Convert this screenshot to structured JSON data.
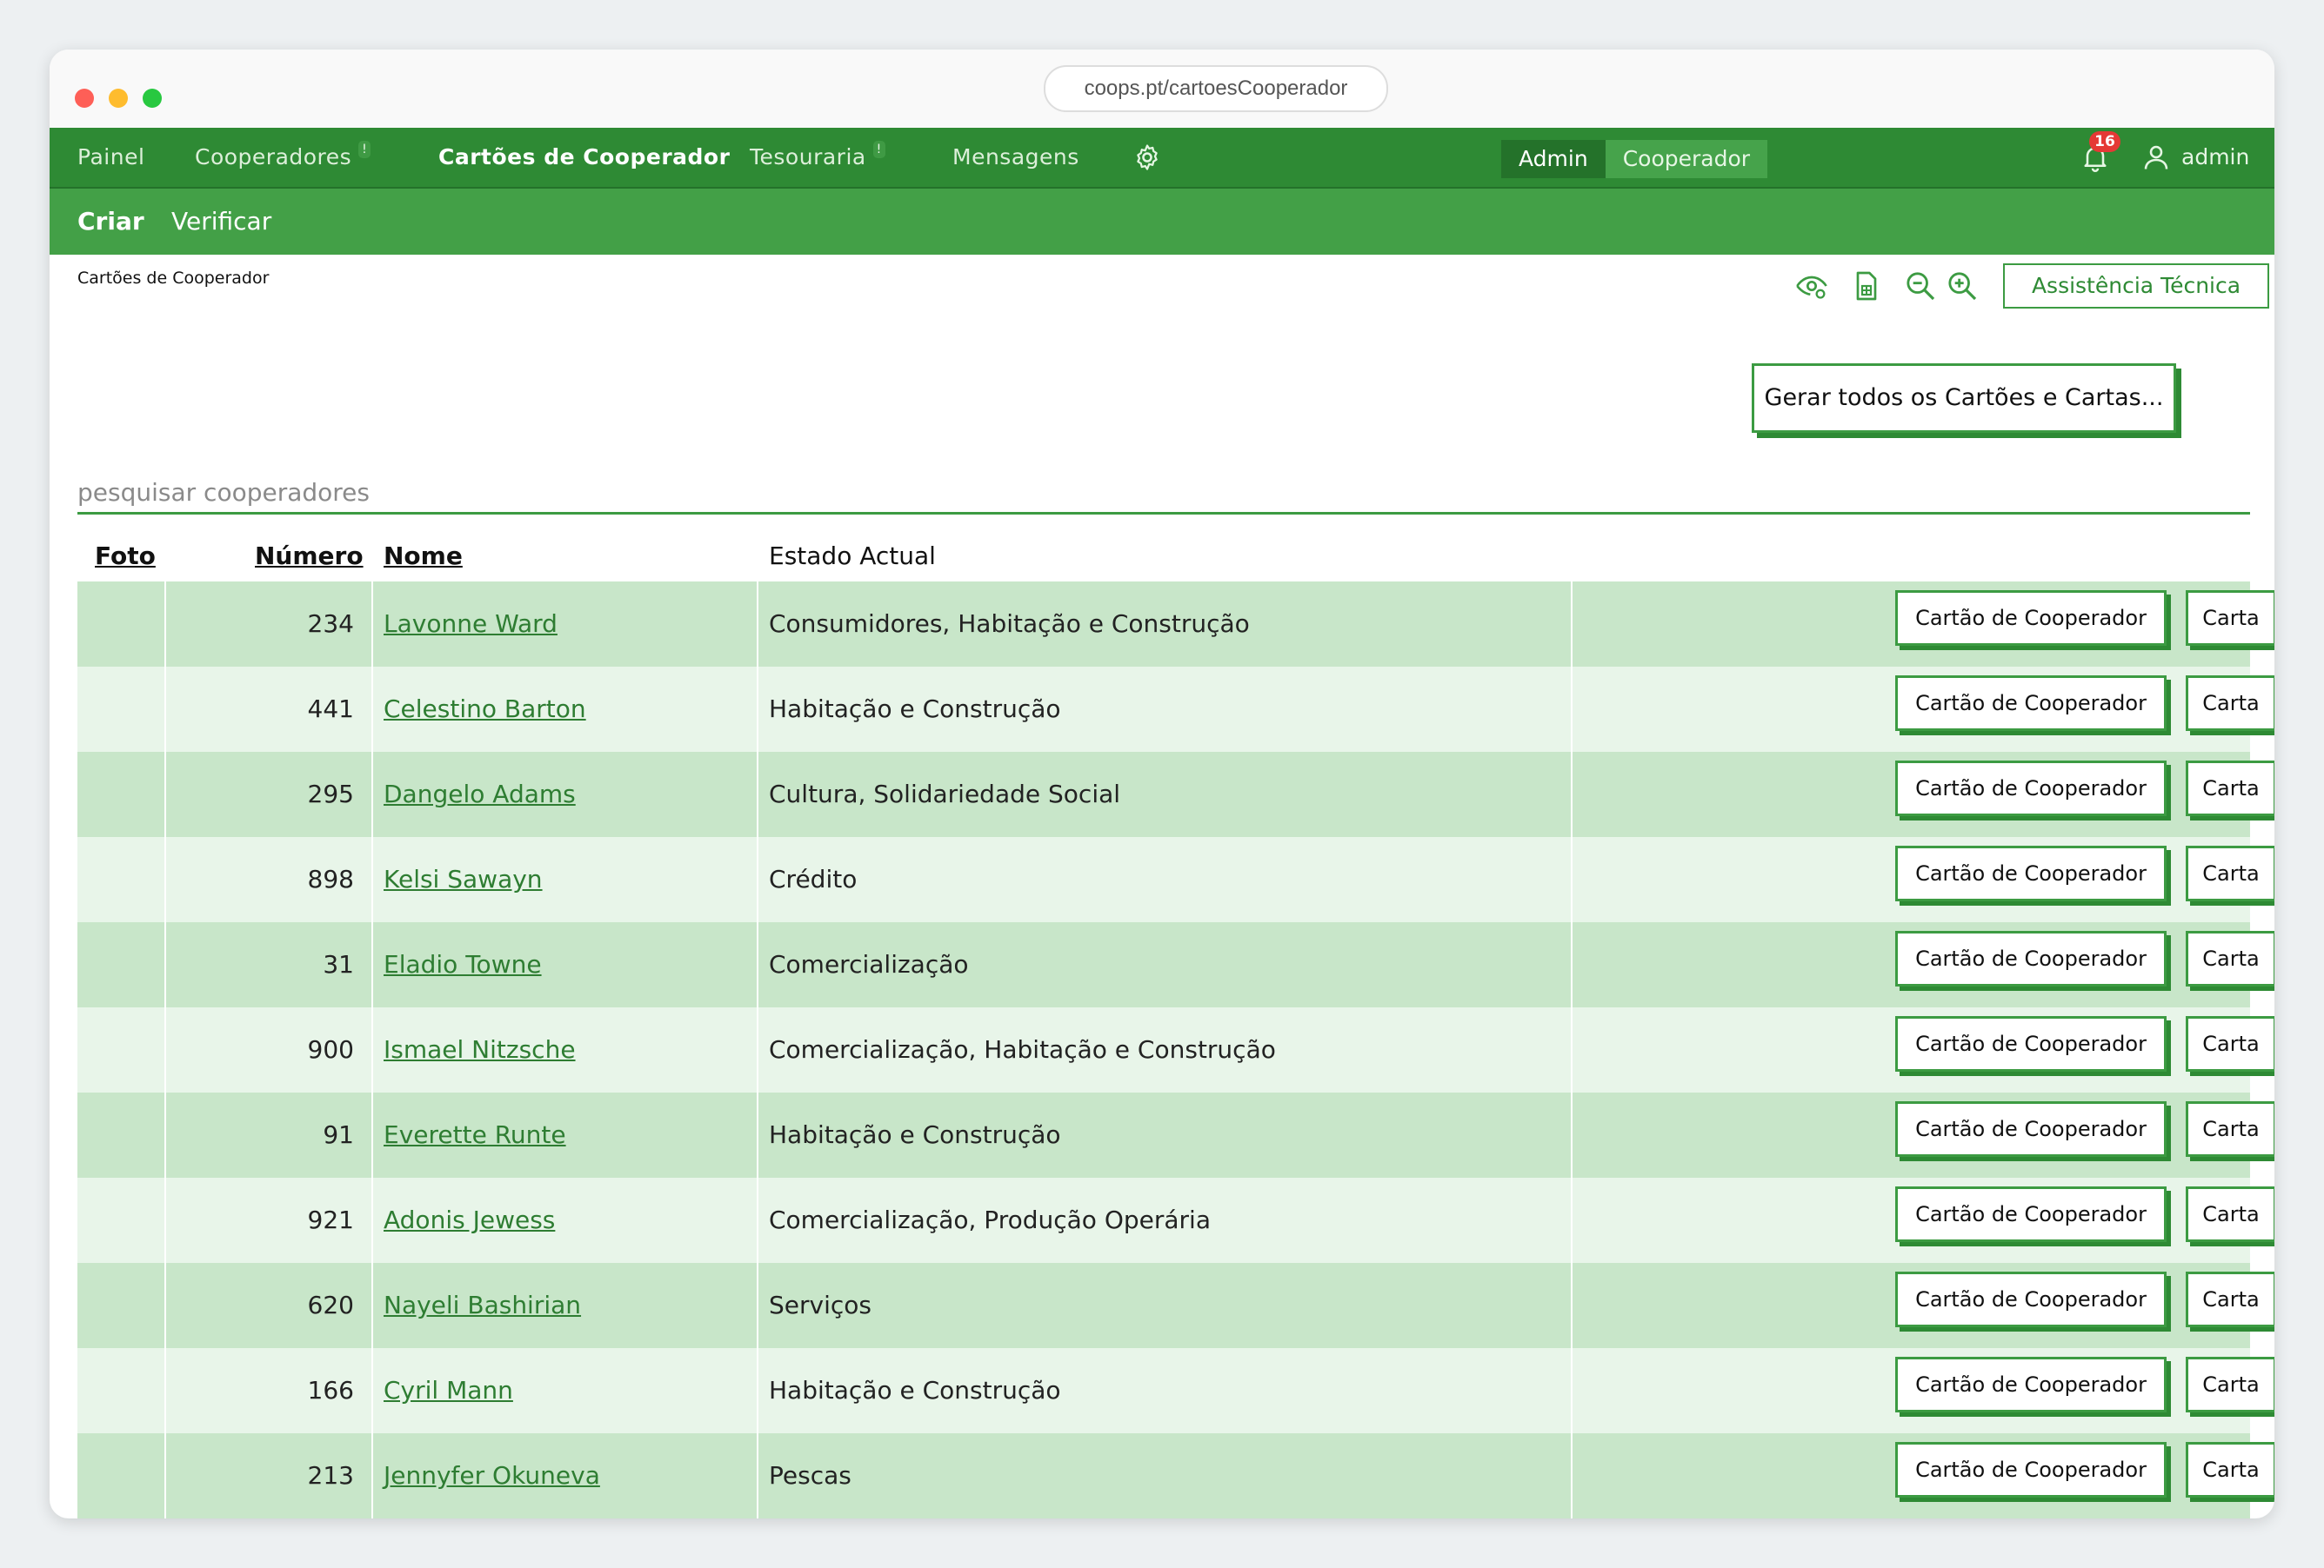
{
  "browser": {
    "url": "coops.pt/cartoesCooperador"
  },
  "nav": {
    "items": [
      {
        "label": "Painel",
        "badge": ""
      },
      {
        "label": "Cooperadores",
        "badge": "!"
      },
      {
        "label": "Cartões de Cooperador",
        "badge": "",
        "active": true
      },
      {
        "label": "Tesouraria",
        "badge": "!"
      },
      {
        "label": "Mensagens",
        "badge": ""
      }
    ],
    "role_admin": "Admin",
    "role_cooperador": "Cooperador",
    "notifications_count": "16",
    "user": "admin"
  },
  "subnav": {
    "criar": "Criar",
    "verificar": "Verificar"
  },
  "breadcrumb": "Cartões de Cooperador",
  "toolbar": {
    "tech_support": "Assistência Técnica"
  },
  "generate_all": "Gerar todos os Cartões e Cartas...",
  "search": {
    "placeholder": "pesquisar cooperadores"
  },
  "table": {
    "headers": {
      "foto": "Foto",
      "numero": "Número",
      "nome": "Nome",
      "estado": "Estado Actual"
    },
    "card_button": "Cartão de Cooperador",
    "letter_button": "Carta",
    "rows": [
      {
        "numero": "234",
        "nome": "Lavonne Ward",
        "estado": "Consumidores, Habitação e Construção"
      },
      {
        "numero": "441",
        "nome": "Celestino Barton",
        "estado": "Habitação e Construção"
      },
      {
        "numero": "295",
        "nome": "Dangelo Adams",
        "estado": "Cultura, Solidariedade Social"
      },
      {
        "numero": "898",
        "nome": "Kelsi Sawayn",
        "estado": "Crédito"
      },
      {
        "numero": "31",
        "nome": "Eladio Towne",
        "estado": "Comercialização"
      },
      {
        "numero": "900",
        "nome": "Ismael Nitzsche",
        "estado": "Comercialização, Habitação e Construção"
      },
      {
        "numero": "91",
        "nome": "Everette Runte",
        "estado": "Habitação e Construção"
      },
      {
        "numero": "921",
        "nome": "Adonis Jewess",
        "estado": "Comercialização, Produção Operária"
      },
      {
        "numero": "620",
        "nome": "Nayeli Bashirian",
        "estado": "Serviços"
      },
      {
        "numero": "166",
        "nome": "Cyril Mann",
        "estado": "Habitação e Construção"
      },
      {
        "numero": "213",
        "nome": "Jennyfer Okuneva",
        "estado": "Pescas"
      }
    ]
  },
  "colors": {
    "primary": "#2e8a34",
    "subnav": "#43a047",
    "row_even": "#c8e6c9",
    "row_odd": "#e8f5e9"
  }
}
